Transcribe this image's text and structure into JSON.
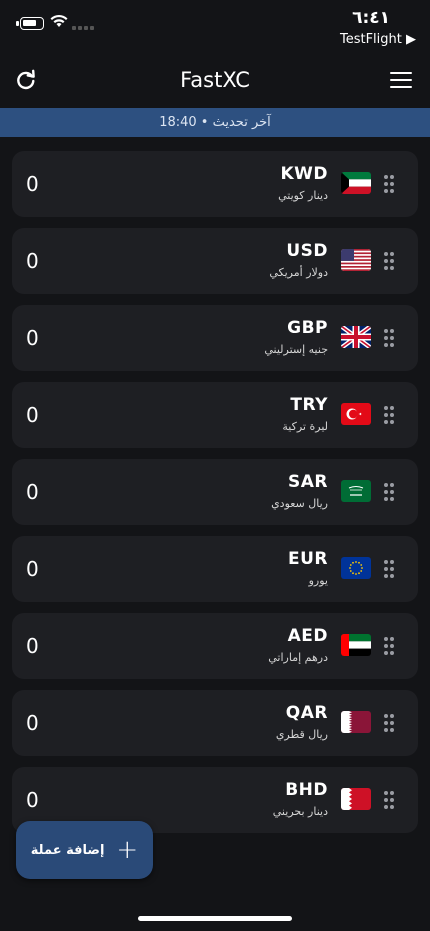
{
  "status_bar": {
    "time": "٦:٤١",
    "back_app": "TestFlight ▶"
  },
  "header": {
    "title": "FastXC",
    "refresh_icon": "refresh-icon",
    "menu_icon": "hamburger-menu-icon"
  },
  "banner": {
    "text": "آخر تحديث • 18:40"
  },
  "currencies": [
    {
      "code": "KWD",
      "name": "دينار كويتي",
      "amount": "0",
      "flag": "kuwait-flag-icon"
    },
    {
      "code": "USD",
      "name": "دولار أمريكي",
      "amount": "0",
      "flag": "usa-flag-icon"
    },
    {
      "code": "GBP",
      "name": "جنيه إسترليني",
      "amount": "0",
      "flag": "uk-flag-icon"
    },
    {
      "code": "TRY",
      "name": "ليرة تركية",
      "amount": "0",
      "flag": "turkey-flag-icon"
    },
    {
      "code": "SAR",
      "name": "ريال سعودي",
      "amount": "0",
      "flag": "saudi-flag-icon"
    },
    {
      "code": "EUR",
      "name": "يورو",
      "amount": "0",
      "flag": "eu-flag-icon"
    },
    {
      "code": "AED",
      "name": "درهم إماراتي",
      "amount": "0",
      "flag": "uae-flag-icon"
    },
    {
      "code": "QAR",
      "name": "ريال قطري",
      "amount": "0",
      "flag": "qatar-flag-icon"
    },
    {
      "code": "BHD",
      "name": "دينار بحريني",
      "amount": "0",
      "flag": "bahrain-flag-icon"
    }
  ],
  "fab": {
    "label": "إضافة عملة",
    "icon": "plus-icon"
  },
  "colors": {
    "background": "#131417",
    "card": "#1e1f23",
    "banner": "#2d5080",
    "fab": "#2a4a78"
  }
}
